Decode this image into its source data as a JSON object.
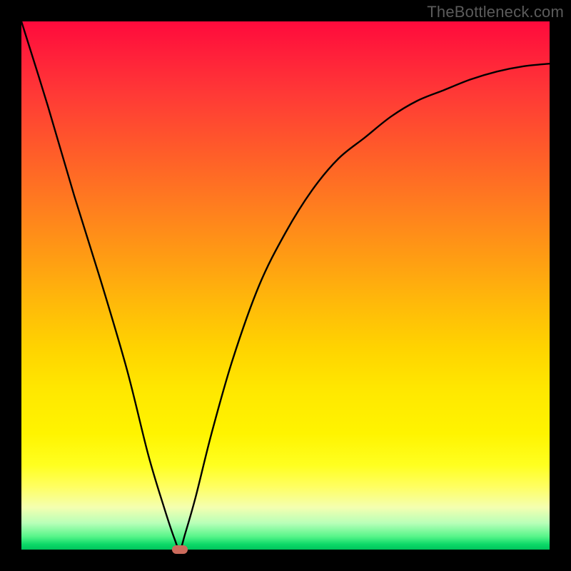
{
  "watermark": "TheBottleneck.com",
  "chart_data": {
    "type": "line",
    "title": "",
    "xlabel": "",
    "ylabel": "",
    "xlim": [
      0,
      100
    ],
    "ylim": [
      0,
      100
    ],
    "grid": false,
    "legend": false,
    "series": [
      {
        "name": "bottleneck-curve",
        "x": [
          0,
          5,
          10,
          15,
          20,
          24,
          27,
          29,
          30,
          31,
          33,
          36,
          40,
          45,
          50,
          55,
          60,
          65,
          70,
          75,
          80,
          85,
          90,
          95,
          100
        ],
        "y": [
          100,
          84,
          67,
          51,
          34,
          18,
          8,
          2,
          0,
          3,
          10,
          22,
          36,
          50,
          60,
          68,
          74,
          78,
          82,
          85,
          87,
          89,
          90.5,
          91.5,
          92
        ],
        "color": "#000000"
      }
    ],
    "marker": {
      "x": 30,
      "y": 0,
      "color": "#cc6b5c"
    },
    "background_gradient": {
      "orientation": "vertical",
      "stops": [
        {
          "pos": 0.0,
          "color": "#ff0a3c"
        },
        {
          "pos": 0.24,
          "color": "#ff5a2a"
        },
        {
          "pos": 0.53,
          "color": "#ffb80a"
        },
        {
          "pos": 0.78,
          "color": "#fff400"
        },
        {
          "pos": 0.95,
          "color": "#b8ffb8"
        },
        {
          "pos": 1.0,
          "color": "#00c45c"
        }
      ]
    }
  }
}
